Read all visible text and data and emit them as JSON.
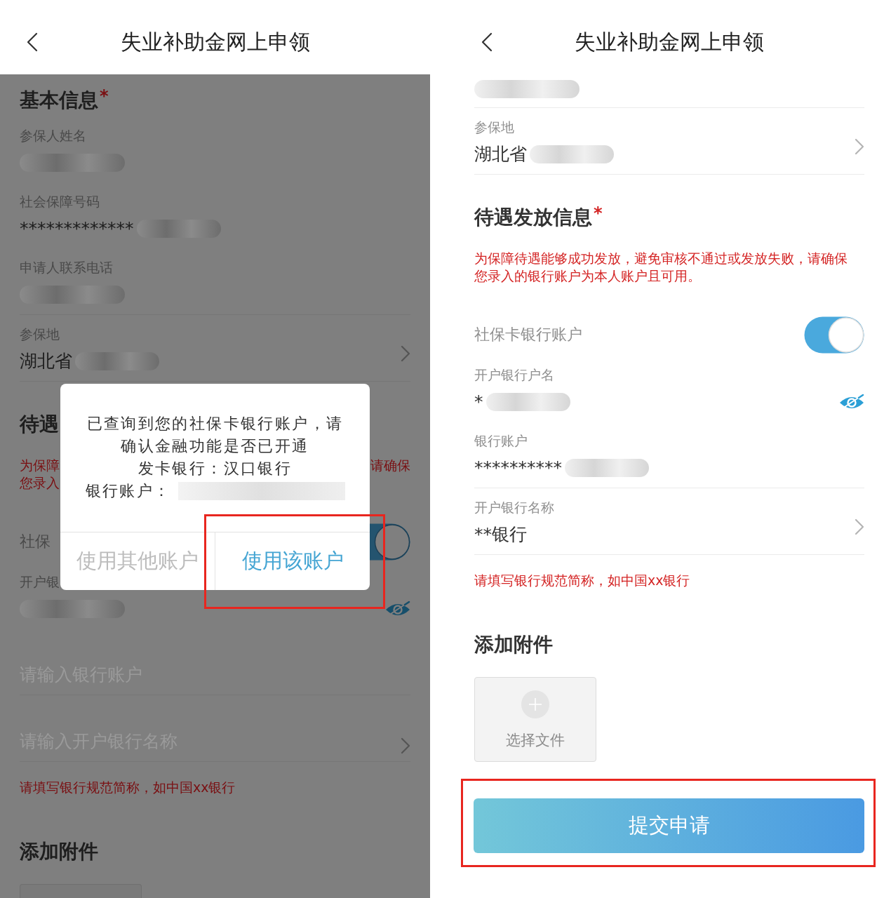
{
  "screens": [
    {
      "dimmed": true,
      "header": {
        "title": "失业补助金网上申领"
      },
      "items": [
        {
          "kind": "heading",
          "text": "基本信息",
          "required_mark": "*"
        },
        {
          "kind": "field",
          "label": "参保人姓名",
          "redacted": true,
          "divider": false
        },
        {
          "kind": "field",
          "label": "社会保障号码",
          "value": "*************",
          "redacted": true,
          "divider": false
        },
        {
          "kind": "field",
          "label": "申请人联系电话",
          "redacted": true,
          "divider": true
        },
        {
          "kind": "field",
          "label": "参保地",
          "value": "湖北省",
          "redacted": true,
          "chevron": true,
          "divider": true
        },
        {
          "kind": "heading",
          "text": "待遇"
        },
        {
          "kind": "notice_fragments",
          "lines": [
            [
              "为保障",
              "请确保"
            ],
            [
              "您录入"
            ]
          ]
        },
        {
          "kind": "toggle",
          "label": "社保",
          "on": true
        },
        {
          "kind": "field",
          "label": "开户银",
          "redacted": true,
          "eye": true,
          "divider": false
        },
        {
          "kind": "input",
          "placeholder": "请输入银行账户"
        },
        {
          "kind": "input",
          "placeholder": "请输入开户银行名称",
          "chevron": true
        },
        {
          "kind": "hint",
          "text": "请填写银行规范简称，如中国xx银行"
        },
        {
          "kind": "heading",
          "text": "添加附件"
        },
        {
          "kind": "upload"
        }
      ],
      "dialog": {
        "message": "已查询到您的社保卡银行账户，请确认金融功能是否已开通",
        "issuer": "发卡银行：汉口银行",
        "account_label": "银行账户：",
        "account_redacted": true,
        "buttons": [
          {
            "label": "使用其他账户",
            "kind": "secondary",
            "highlighted": false
          },
          {
            "label": "使用该账户",
            "kind": "primary",
            "highlighted": true
          }
        ]
      }
    },
    {
      "dimmed": false,
      "header": {
        "title": "失业补助金网上申领"
      },
      "items": [
        {
          "kind": "field",
          "redacted": true,
          "divider": true
        },
        {
          "kind": "field",
          "label": "参保地",
          "value": "湖北省",
          "redacted": true,
          "chevron": true,
          "divider": true
        },
        {
          "kind": "heading",
          "text": "待遇发放信息",
          "required_mark": "*"
        },
        {
          "kind": "notice",
          "text": "为保障待遇能够成功发放，避免审核不通过或发放失败，请确保您录入的银行账户为本人账户且可用。"
        },
        {
          "kind": "toggle",
          "label": "社保卡银行账户",
          "on": true
        },
        {
          "kind": "field",
          "label": "开户银行户名",
          "value": "*",
          "redacted": true,
          "eye": true,
          "divider": false
        },
        {
          "kind": "field",
          "label": "银行账户",
          "value": "**********",
          "redacted": true,
          "divider": true
        },
        {
          "kind": "field",
          "label": "开户银行名称",
          "value": "**银行",
          "chevron": true,
          "divider": true
        },
        {
          "kind": "hint",
          "text": "请填写银行规范简称，如中国xx银行"
        },
        {
          "kind": "heading",
          "text": "添加附件"
        },
        {
          "kind": "upload",
          "label": "选择文件"
        },
        {
          "kind": "button",
          "label": "提交申请",
          "highlighted": true
        }
      ]
    }
  ]
}
